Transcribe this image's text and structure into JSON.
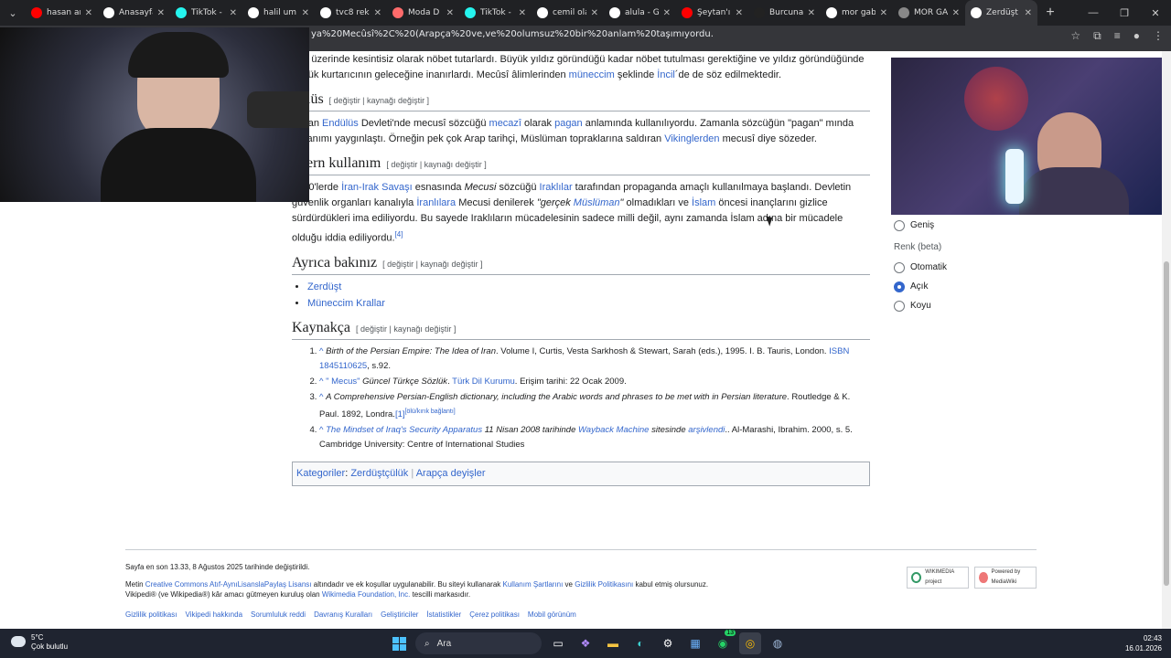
{
  "browser": {
    "tabs": [
      {
        "title": "hasan an",
        "color": "#ff0000"
      },
      {
        "title": "Anasayfa",
        "color": "#ffffff"
      },
      {
        "title": "TikTok -",
        "color": "#25f4ee"
      },
      {
        "title": "halil um",
        "color": "#ffffff"
      },
      {
        "title": "tvc8 reki",
        "color": "#ffffff"
      },
      {
        "title": "Moda D",
        "color": "#ff6b6b"
      },
      {
        "title": "TikTok -",
        "color": "#25f4ee"
      },
      {
        "title": "cemil ola",
        "color": "#ffffff"
      },
      {
        "title": "alula - G",
        "color": "#ffffff"
      },
      {
        "title": "Şeytan'ı",
        "color": "#ff0000"
      },
      {
        "title": "Burcuna",
        "color": "#222222"
      },
      {
        "title": "mor gab",
        "color": "#ffffff"
      },
      {
        "title": "MOR GA",
        "color": "#888888"
      },
      {
        "title": "Zerdüşt",
        "color": "#ffffff",
        "active": true
      }
    ],
    "url": "ya%20Mecûsî%2C%20(Arapça%20ve,ve%20olumsuz%20bir%20anlam%20taşımıyordu."
  },
  "article": {
    "intro_frag1": "ı ün üzerinde kesintisiz olarak nöbet tutarlardı. Büyük yıldız göründüğü kadar nöbet tutulması gerektiğine ve yıldız göründüğünde",
    "intro_frag2": "büyük kurtarıcının geleceğine inanırlardı. Mecûsî âlimlerinden ",
    "intro_link1": "müneccim",
    "intro_frag3": " şeklinde ",
    "intro_link2": "İncil",
    "intro_frag4": "´de de söz edilmektedir.",
    "sec_endulus": {
      "title": "dülüs",
      "edit": "[ değiştir | kaynağı değiştir ]",
      "p_start": "lüman ",
      "link1": "Endülüs",
      "t1": " Devleti'nde mecusî sözcüğü ",
      "link2": "mecazî",
      "t2": " olarak ",
      "link3": "pagan",
      "t3": " anlamında kullanılıyordu. Zamanla sözcüğün \"pagan\"",
      "t4": "mında kullanımı yaygınlaştı. Örneğin pek çok Arap tarihçi, Müslüman topraklarına saldıran ",
      "link4": "Vikinglerden",
      "t5": " mecusî diye sözeder."
    },
    "sec_modern": {
      "title": "odern kullanım",
      "edit": "[ değiştir | kaynağı değiştir ]",
      "t1": "1980'lerde ",
      "link1": "İran-Irak Savaşı",
      "t2": " esnasında ",
      "em1": "Mecusi",
      "t3": " sözcüğü ",
      "link2": "Iraklılar",
      "t4": " tarafından propaganda amaçlı kullanılmaya başlandı. Devletin güvenlik organları kanalıyla ",
      "link3": "İranlılara",
      "t5": " Mecusi denilerek ",
      "em2": "\"gerçek ",
      "link4": "Müslüman",
      "em3": "\"",
      "t6": " olmadıkları ve ",
      "link5": "İslam",
      "t7": " öncesi inançlarını gizlice sürdürdükleri ima ediliyordu. Bu sayede Iraklıların mücadelesinin sadece milli değil, aynı zamanda İslam adına bir mücadele olduğu iddia ediliyordu.",
      "sup": "[4]"
    },
    "sec_see": {
      "title": "Ayrıca bakınız",
      "edit": "[ değiştir | kaynağı değiştir ]",
      "items": [
        "Zerdüşt",
        "Müneccim Krallar"
      ]
    },
    "sec_refs": {
      "title": "Kaynakça",
      "edit": "[ değiştir | kaynağı değiştir ]",
      "r1_caret": "^",
      "r1_em": "Birth of the Persian Empire: The Idea of Iran",
      "r1_t": ". Volume I, Curtis, Vesta Sarkhosh & Stewart, Sarah (eds.), 1995. I. B. Tauris, London. ",
      "r1_link": "ISBN 1845110625",
      "r1_t2": ", s.92.",
      "r2_caret": "^",
      "r2_link": "\" Mecus\"",
      "r2_em": " Güncel Türkçe Sözlük",
      "r2_t": ". ",
      "r2_link2": "Türk Dil Kurumu",
      "r2_t2": ". Erişim tarihi: 22 Ocak 2009.",
      "r3_caret": "^",
      "r3_em": "A Comprehensive Persian-English dictionary, including the Arabic words and phrases to be met with in Persian literature",
      "r3_t": ". Routledge & K. Paul. 1892, Londra.",
      "r3_link": "[1]",
      "r3_sup": "[ölü/kırık bağlantı]",
      "r4_caret": "^",
      "r4_link": "The Mindset of Iraq's Security Apparatus",
      "r4_em": " 11 Nisan 2008 tarihinde ",
      "r4_link2": "Wayback Machine",
      "r4_em2": " sitesinde ",
      "r4_link3": "arşivlendi",
      "r4_t": ".. Al-Marashi, Ibrahim. 2000, s. 5. Cambridge University: Centre of International Studies"
    },
    "categories": {
      "label": "Kategoriler",
      "items": [
        "Zerdüştçülük",
        "Arapça deyişler"
      ]
    }
  },
  "side": {
    "width_option": "Geniş",
    "color_label": "Renk (beta)",
    "options": [
      "Otomatik",
      "Açık",
      "Koyu"
    ],
    "selected": "Açık"
  },
  "footer": {
    "modified": "Sayfa en son 13.33, 8 Ağustos 2025 tarihinde değiştirildi.",
    "license_t1": "Metin ",
    "license_link": "Creative Commons Atıf-AynıLisanslaPaylaş Lisansı",
    "license_t2": " altındadır ve ek koşullar uygulanabilir. Bu siteyi kullanarak ",
    "terms_link": "Kullanım Şartlarını",
    "license_t3": " ve ",
    "privacy_link": "Gizlilik Politikasını",
    "license_t4": " kabul etmiş olursunuz.",
    "trademark_t1": "Vikipedi® (ve Wikipedia®) kâr amacı gütmeyen kuruluş olan ",
    "wmf_link": "Wikimedia Foundation, Inc.",
    "trademark_t2": " tescilli markasıdır.",
    "links": [
      "Gizlilik politikası",
      "Vikipedi hakkında",
      "Sorumluluk reddi",
      "Davranış Kuralları",
      "Geliştiriciler",
      "İstatistikler",
      "Çerez politikası",
      "Mobil görünüm"
    ],
    "badge1": "WIKIMEDIA project",
    "badge2": "Powered by MediaWiki"
  },
  "taskbar": {
    "temp": "5°C",
    "weather": "Çok bulutlu",
    "search": "Ara",
    "time": "02:43",
    "date": "16.01.2026",
    "badge": "13"
  }
}
